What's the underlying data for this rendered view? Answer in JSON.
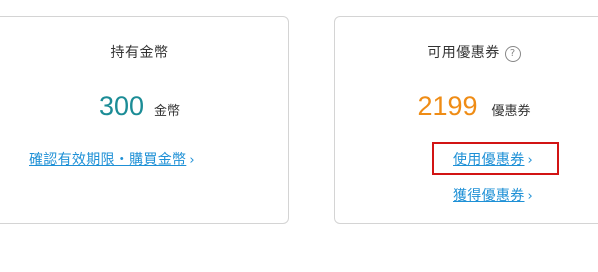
{
  "coins": {
    "title": "持有金幣",
    "amount": "300",
    "unit": "金幣",
    "link_label": "確認有效期限・購買金幣"
  },
  "coupons": {
    "title": "可用優惠券",
    "help_icon": "question-circle-icon",
    "help_glyph": "?",
    "amount": "2199",
    "unit": "優惠券",
    "use_link_label": "使用優惠券",
    "get_link_label": "獲得優惠券"
  },
  "chevron_glyph": "›",
  "colors": {
    "coins_amount": "#1b8c96",
    "coupons_amount": "#ef8c15",
    "link": "#1e90d6",
    "highlight": "#d21414"
  }
}
